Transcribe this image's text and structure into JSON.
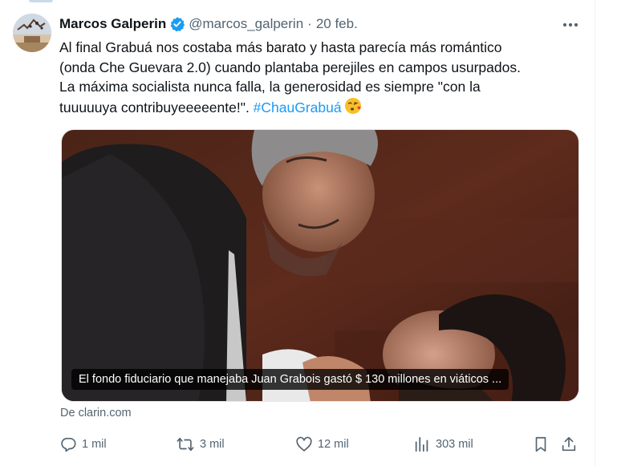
{
  "tweet": {
    "author_name": "Marcos Galperin",
    "handle": "@marcos_galperin",
    "separator": "·",
    "date": "20 feb.",
    "text_lines": [
      "Al final Grabuá nos costaba más barato y hasta parecía más romántico",
      "(onda Che Guevara 2.0) cuando plantaba perejiles en campos usurpados.",
      "La máxima socialista nunca falla, la generosidad es siempre \"con la",
      "tuuuuuya contribuyeeeeente!\". "
    ],
    "hashtag": "#ChauGrabuá",
    "emoji": "face-blowing-kiss",
    "card": {
      "caption": "El fondo fiduciario que manejaba Juan Grabois gastó $ 130 millones en viáticos ...",
      "source": "De clarin.com"
    },
    "actions": {
      "replies": "1 mil",
      "reposts": "3 mil",
      "likes": "12 mil",
      "views": "303 mil"
    }
  },
  "colors": {
    "text": "#0f1419",
    "secondary": "#536471",
    "accent": "#1d9bf0"
  }
}
